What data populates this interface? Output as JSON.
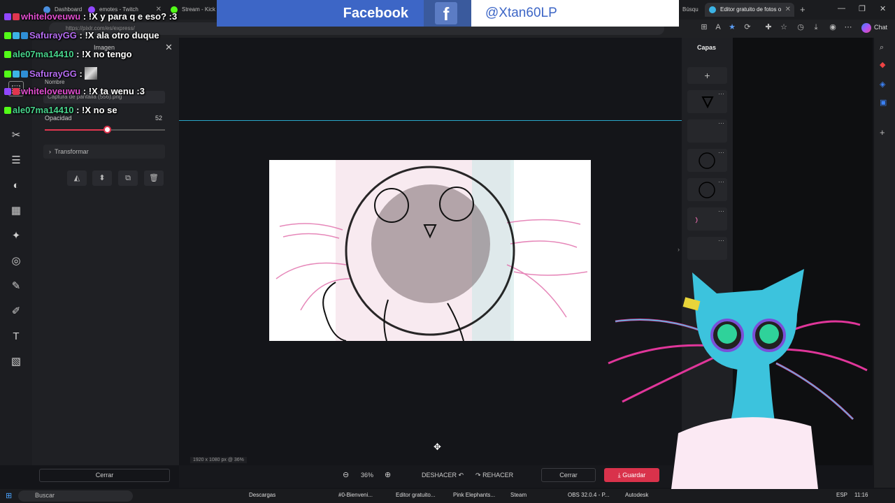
{
  "browser": {
    "tabs": [
      {
        "label": "Dashboard"
      },
      {
        "label": "emotes - Twitch"
      },
      {
        "label": "Stream - Kick"
      },
      {
        "label": "Búsqu"
      },
      {
        "label": "Editor gratuito de fotos o"
      }
    ],
    "url": "https://pixlr.com/es/express/",
    "chat_label": "Chat"
  },
  "banner": {
    "facebook_label": "Facebook",
    "logo_letter": "f",
    "handle": "@Xtan60LP"
  },
  "properties": {
    "section_title": "Imagen",
    "name_label": "Nombre",
    "name_value": "Captura de pantalla (556).png",
    "opacity_label": "Opacidad",
    "opacity_value": "52",
    "opacity_fraction": 0.52,
    "transform_label": "Transformar",
    "close_label": "Cerrar"
  },
  "canvas": {
    "size_note": "1920 x 1080 px @ 36%"
  },
  "bottombar": {
    "zoom": "36%",
    "undo_label": "DESHACER",
    "redo_label": "REHACER",
    "close_label": "Cerrar",
    "save_label": "Guardar"
  },
  "layers": {
    "title": "Capas",
    "add_symbol": "+"
  },
  "chat": [
    {
      "user": "whiteloveuwu",
      "text": " : !X y para q e eso? :3"
    },
    {
      "user": "SafurayGG",
      "text": " : !X ala otro duque"
    },
    {
      "user": "ale07ma14410",
      "text": " : !X no tengo"
    },
    {
      "user": "SafurayGG",
      "text": " : "
    },
    {
      "user": "whiteloveuwu",
      "text": " : !X ta wenu :3"
    },
    {
      "user": "ale07ma14410",
      "text": " : !X no se"
    }
  ],
  "taskbar": {
    "search": "Buscar",
    "items": [
      "Descargas",
      "#0-Bienveni...",
      "Editor gratuito...",
      "Pink Elephants...",
      "Steam",
      "OBS 32.0.4 - P...",
      "Autodesk"
    ],
    "lang": "ESP",
    "time": "11:16"
  },
  "colors": {
    "accent": "#d9324b",
    "guide": "#2aa7c8",
    "facebook_blue": "#3d66c6"
  }
}
